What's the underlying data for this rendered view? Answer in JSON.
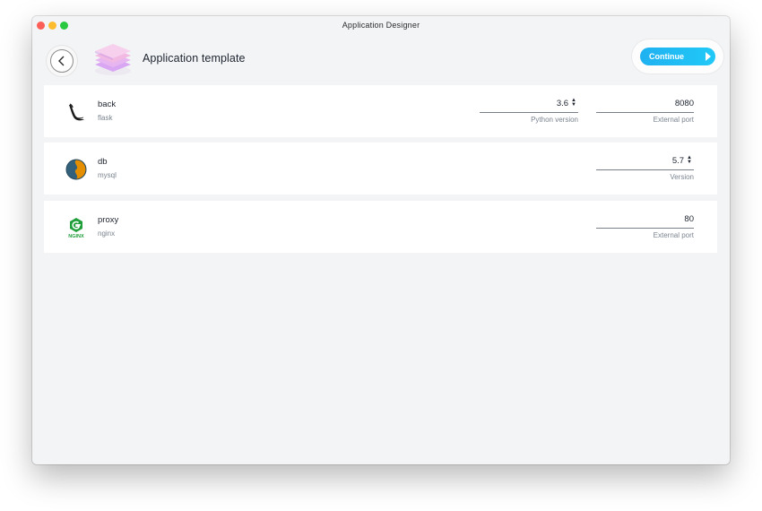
{
  "window": {
    "title": "Application Designer"
  },
  "header": {
    "title": "Application template",
    "continue_label": "Continue"
  },
  "services": [
    {
      "name": "back",
      "type": "flask",
      "icon": "flask-icon",
      "fields": [
        {
          "value": "3.6",
          "label": "Python version",
          "spinner": true
        },
        {
          "value": "8080",
          "label": "External port",
          "spinner": false
        }
      ]
    },
    {
      "name": "db",
      "type": "mysql",
      "icon": "mysql-icon",
      "fields": [
        {
          "value": "5.7",
          "label": "Version",
          "spinner": true
        }
      ]
    },
    {
      "name": "proxy",
      "type": "nginx",
      "icon": "nginx-icon",
      "fields": [
        {
          "value": "80",
          "label": "External port",
          "spinner": false
        }
      ]
    }
  ],
  "colors": {
    "accent": "#1fb1f1",
    "window_bg": "#f3f4f6",
    "nginx_green": "#1f9e3a",
    "mysql_blue": "#33607a",
    "mysql_orange": "#e48e00"
  }
}
